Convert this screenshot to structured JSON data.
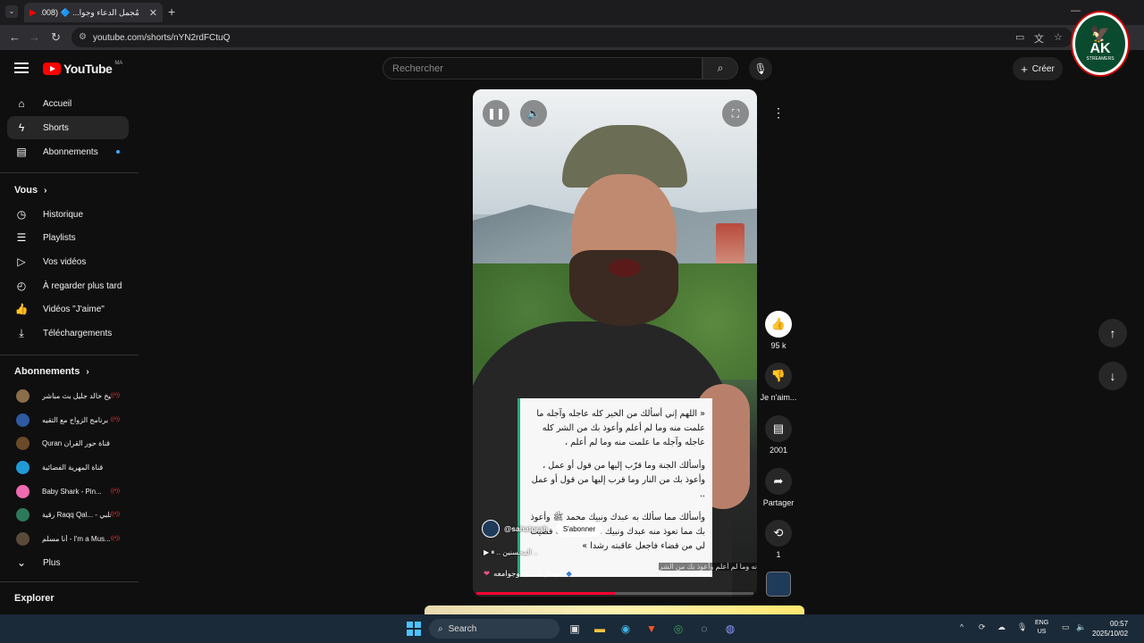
{
  "browser": {
    "tab_title": "مُجمل الدعاء وجوا... 🔷 (1008)",
    "tab_close": "✕",
    "new_tab": "+",
    "url": "youtube.com/shorts/nYN2rdFCtuQ"
  },
  "youtube": {
    "logo_text": "YouTube",
    "country_code": "MA",
    "search_placeholder": "Rechercher",
    "create_label": "Créer",
    "avatar_text": "AK",
    "avatar_sub": "STREAMERS"
  },
  "sidebar": {
    "main_items": [
      {
        "label": "Accueil",
        "icon": "home-icon"
      },
      {
        "label": "Shorts",
        "icon": "shorts-icon",
        "active": true
      },
      {
        "label": "Abonnements",
        "icon": "subscriptions-icon"
      }
    ],
    "you_heading": "Vous",
    "you_items": [
      {
        "label": "Historique",
        "icon": "history-icon"
      },
      {
        "label": "Playlists",
        "icon": "playlists-icon"
      },
      {
        "label": "Vos vidéos",
        "icon": "your-videos-icon"
      },
      {
        "label": "À regarder plus tard",
        "icon": "watch-later-icon"
      },
      {
        "label": "Vidéos \"J'aime\"",
        "icon": "liked-icon"
      },
      {
        "label": "Téléchargements",
        "icon": "downloads-icon"
      }
    ],
    "subs_heading": "Abonnements",
    "subscriptions": [
      {
        "label": "الشيخ خالد جليل بث مباشر",
        "color": "#8a6d4a"
      },
      {
        "label": "برنامج الزواج مع التقيه",
        "color": "#2d5aa0"
      },
      {
        "label": "Quran قناة حور القران",
        "color": "#6a4a2a"
      },
      {
        "label": "قناة المهرية الفضائية",
        "color": "#1f9ad6"
      },
      {
        "label": "Baby Shark - Pin...",
        "color": "#f06ab0"
      },
      {
        "label": "رقية Raqq Qal... - رقّ قلبي",
        "color": "#2d7a5a"
      },
      {
        "label": "أنا مسلم - I'm a Mus...",
        "color": "#5a4a3a"
      }
    ],
    "more_label": "Plus",
    "explore_heading": "Explorer"
  },
  "video": {
    "text_paragraphs": [
      "« اللهم إني أسألك من الخير كله عاجله وآجله ما علمت منه وما لم أعلم وأعوذ بك من الشر كله عاجله وآجله ما علمت منه وما لم أعلم ،",
      "وأسألك الجنة وما قرّب إليها من قول أو عمل ، وأعوذ بك من النار وما قرب إليها من قول أو عمل ..",
      "وأسألك مما سألك به عبدك ونبيك محمد ﷺ وأعوذ بك مما تعوذ منه عبدك ونبيك محمد ﷺ وما قضيت لي من قضاء فاجعل عاقبته رشدا »"
    ],
    "channel_handle": "@sahatorah",
    "subscribe_label": "S'abonner",
    "playline": "▶ ⏸ .. المحسنين ..",
    "overlay_sub": "نه وما لم أعلم وأعوذ بك من الشر",
    "caption": "مُجمل الدعاء وجوامعه",
    "progress": 0.5
  },
  "actions": {
    "like_count": "95 k",
    "dislike_label": "Je n'aim...",
    "comments_count": "2001",
    "share_label": "Partager",
    "remix_count": "1"
  },
  "taskbar": {
    "search_label": "Search",
    "lang_line1": "ENG",
    "lang_line2": "US",
    "time": "00:57",
    "date": "2025/10/02"
  }
}
